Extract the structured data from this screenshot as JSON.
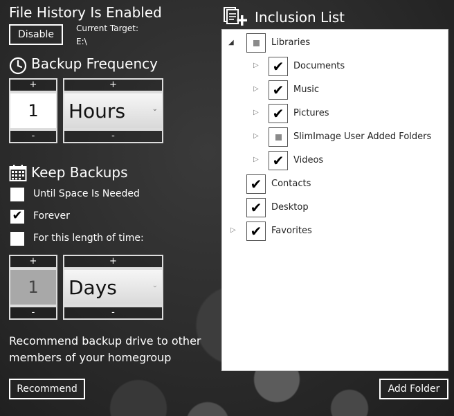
{
  "status": {
    "title": "File History Is Enabled",
    "disable_label": "Disable",
    "target_label": "Current Target:",
    "target_value": "E:\\"
  },
  "backup_frequency": {
    "title": "Backup Frequency",
    "number": "1",
    "unit": "Hours",
    "plus": "+",
    "minus": "-"
  },
  "keep_backups": {
    "title": "Keep Backups",
    "options": [
      {
        "label": "Until Space Is Needed",
        "checked": false
      },
      {
        "label": "Forever",
        "checked": true
      },
      {
        "label": "For this length of time:",
        "checked": false
      }
    ],
    "number": "1",
    "unit": "Days",
    "plus": "+",
    "minus": "-"
  },
  "recommend": {
    "text_line1": "Recommend backup drive to other",
    "text_line2": "members of your homegroup",
    "button_label": "Recommend"
  },
  "inclusion": {
    "title": "Inclusion List",
    "add_folder_label": "Add Folder",
    "items": [
      {
        "label": "Libraries",
        "state": "partial",
        "arrow": "expanded"
      },
      {
        "label": "Documents",
        "state": "checked",
        "arrow": "collapsed"
      },
      {
        "label": "Music",
        "state": "checked",
        "arrow": "collapsed"
      },
      {
        "label": "Pictures",
        "state": "checked",
        "arrow": "collapsed"
      },
      {
        "label": "SlimImage User Added Folders",
        "state": "partial",
        "arrow": "collapsed"
      },
      {
        "label": "Videos",
        "state": "checked",
        "arrow": "collapsed"
      },
      {
        "label": "Contacts",
        "state": "checked",
        "arrow": "none"
      },
      {
        "label": "Desktop",
        "state": "checked",
        "arrow": "none"
      },
      {
        "label": "Favorites",
        "state": "checked",
        "arrow": "collapsed"
      }
    ]
  }
}
